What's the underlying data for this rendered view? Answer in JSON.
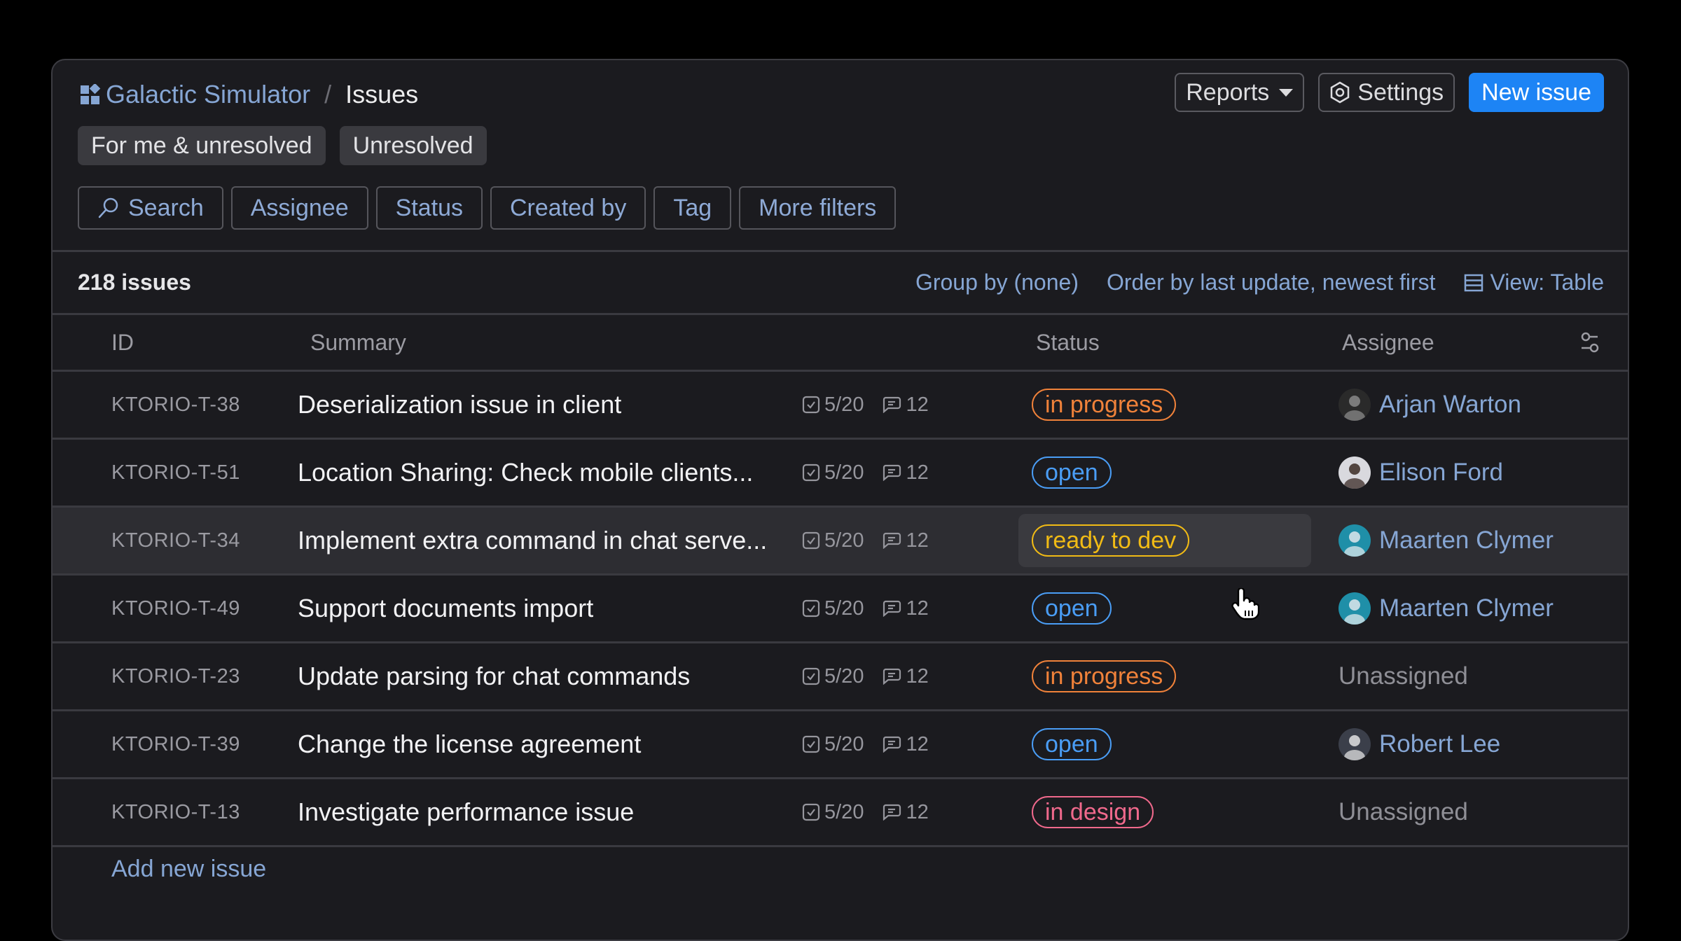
{
  "breadcrumb": {
    "project": "Galactic Simulator",
    "separator": "/",
    "current": "Issues"
  },
  "header_actions": {
    "reports": "Reports",
    "settings": "Settings",
    "new_issue": "New issue"
  },
  "presets": [
    "For me & unresolved",
    "Unresolved"
  ],
  "filters": {
    "search": "Search",
    "assignee": "Assignee",
    "status": "Status",
    "created_by": "Created by",
    "tag": "Tag",
    "more": "More filters"
  },
  "toolbar": {
    "count": "218 issues",
    "group_by": "Group by (none)",
    "order_by": "Order by last update, newest first",
    "view": "View: Table"
  },
  "columns": {
    "id": "ID",
    "summary": "Summary",
    "status": "Status",
    "assignee": "Assignee"
  },
  "status_colors": {
    "in progress": "#f0823a",
    "open": "#4a9df5",
    "ready to dev": "#f1bb15",
    "in design": "#f0698c"
  },
  "issues": [
    {
      "id": "KTORIO-T-38",
      "summary": "Deserialization issue in client",
      "checklist": "5/20",
      "comments": "12",
      "status": "in progress",
      "assignee": "Arjan Warton"
    },
    {
      "id": "KTORIO-T-51",
      "summary": "Location Sharing: Check mobile clients...",
      "checklist": "5/20",
      "comments": "12",
      "status": "open",
      "assignee": "Elison Ford"
    },
    {
      "id": "KTORIO-T-34",
      "summary": "Implement extra command in chat serve...",
      "checklist": "5/20",
      "comments": "12",
      "status": "ready to dev",
      "assignee": "Maarten Clymer"
    },
    {
      "id": "KTORIO-T-49",
      "summary": "Support documents import",
      "checklist": "5/20",
      "comments": "12",
      "status": "open",
      "assignee": "Maarten Clymer"
    },
    {
      "id": "KTORIO-T-23",
      "summary": "Update parsing for chat commands",
      "checklist": "5/20",
      "comments": "12",
      "status": "in progress",
      "assignee": "Unassigned"
    },
    {
      "id": "KTORIO-T-39",
      "summary": "Change the license agreement",
      "checklist": "5/20",
      "comments": "12",
      "status": "open",
      "assignee": "Robert Lee"
    },
    {
      "id": "KTORIO-T-13",
      "summary": "Investigate performance issue",
      "checklist": "5/20",
      "comments": "12",
      "status": "in design",
      "assignee": "Unassigned"
    }
  ],
  "add_issue": "Add new issue"
}
